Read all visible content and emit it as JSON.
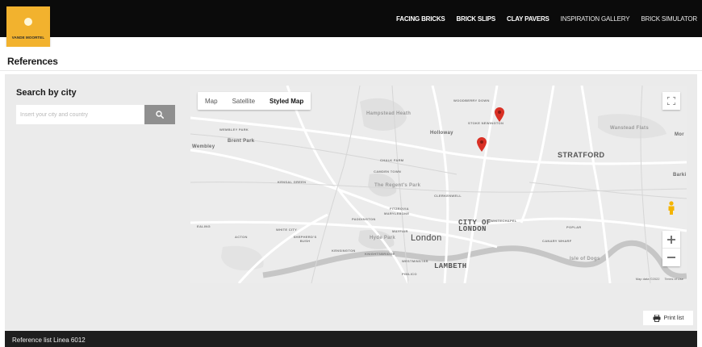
{
  "brand": {
    "logo_text": "VANDE MOORTEL",
    "accent_color": "#f2b22e",
    "topbar_color": "#0b0b0b"
  },
  "nav": {
    "items": [
      {
        "label": "FACING BRICKS",
        "bold": true
      },
      {
        "label": "BRICK SLIPS",
        "bold": true
      },
      {
        "label": "CLAY PAVERS",
        "bold": true
      },
      {
        "label": "INSPIRATION GALLERY",
        "bold": false
      },
      {
        "label": "BRICK SIMULATOR",
        "bold": false
      }
    ]
  },
  "page": {
    "title": "References"
  },
  "search": {
    "heading": "Search by city",
    "placeholder": "Insert your city and country",
    "button_icon": "search-icon"
  },
  "map": {
    "type_buttons": [
      {
        "label": "Map",
        "active": false
      },
      {
        "label": "Satellite",
        "active": false
      },
      {
        "label": "Styled Map",
        "active": true
      }
    ],
    "labels": [
      {
        "text": "Wembley",
        "cls": "med"
      },
      {
        "text": "Brent Park",
        "cls": "med"
      },
      {
        "text": "WEMBLEY PARK",
        "cls": ""
      },
      {
        "text": "Hampstead Heath",
        "cls": "med"
      },
      {
        "text": "Holloway",
        "cls": "med"
      },
      {
        "text": "WOODBERRY DOWN",
        "cls": ""
      },
      {
        "text": "STOKE NEWINGTON",
        "cls": ""
      },
      {
        "text": "Wanstead Flats",
        "cls": "med"
      },
      {
        "text": "STRATFORD",
        "cls": "big"
      },
      {
        "text": "CHALK FARM",
        "cls": ""
      },
      {
        "text": "CAMDEN TOWN",
        "cls": ""
      },
      {
        "text": "KENSAL GREEN",
        "cls": ""
      },
      {
        "text": "The Regent's Park",
        "cls": "med"
      },
      {
        "text": "CLERKENWELL",
        "cls": ""
      },
      {
        "text": "FITZROVIA",
        "cls": ""
      },
      {
        "text": "MARYLEBONE",
        "cls": ""
      },
      {
        "text": "PADDINGTON",
        "cls": ""
      },
      {
        "text": "EALING",
        "cls": ""
      },
      {
        "text": "ACTON",
        "cls": ""
      },
      {
        "text": "WHITE CITY",
        "cls": ""
      },
      {
        "text": "SHEPHERD'S BUSH",
        "cls": ""
      },
      {
        "text": "MAYFAIR",
        "cls": ""
      },
      {
        "text": "Hyde Park",
        "cls": "med"
      },
      {
        "text": "KENSINGTON",
        "cls": ""
      },
      {
        "text": "KNIGHTSBRIDGE",
        "cls": ""
      },
      {
        "text": "CITY OF LONDON",
        "cls": "big mono"
      },
      {
        "text": "WHITECHAPEL",
        "cls": ""
      },
      {
        "text": "London",
        "cls": "city"
      },
      {
        "text": "WESTMINSTER",
        "cls": ""
      },
      {
        "text": "LAMBETH",
        "cls": "big mono"
      },
      {
        "text": "PIMLICO",
        "cls": ""
      },
      {
        "text": "POPLAR",
        "cls": ""
      },
      {
        "text": "CANARY WHARF",
        "cls": ""
      },
      {
        "text": "Isle of Dogs",
        "cls": "med"
      },
      {
        "text": "Barki",
        "cls": "med"
      },
      {
        "text": "Mor",
        "cls": "med"
      }
    ],
    "attribution": "Map data ©2022",
    "terms": "Terms of Use",
    "pin_color": "#d93025"
  },
  "actions": {
    "print_label": "Print list"
  },
  "footer": {
    "title": "Reference list Linea 6012"
  }
}
